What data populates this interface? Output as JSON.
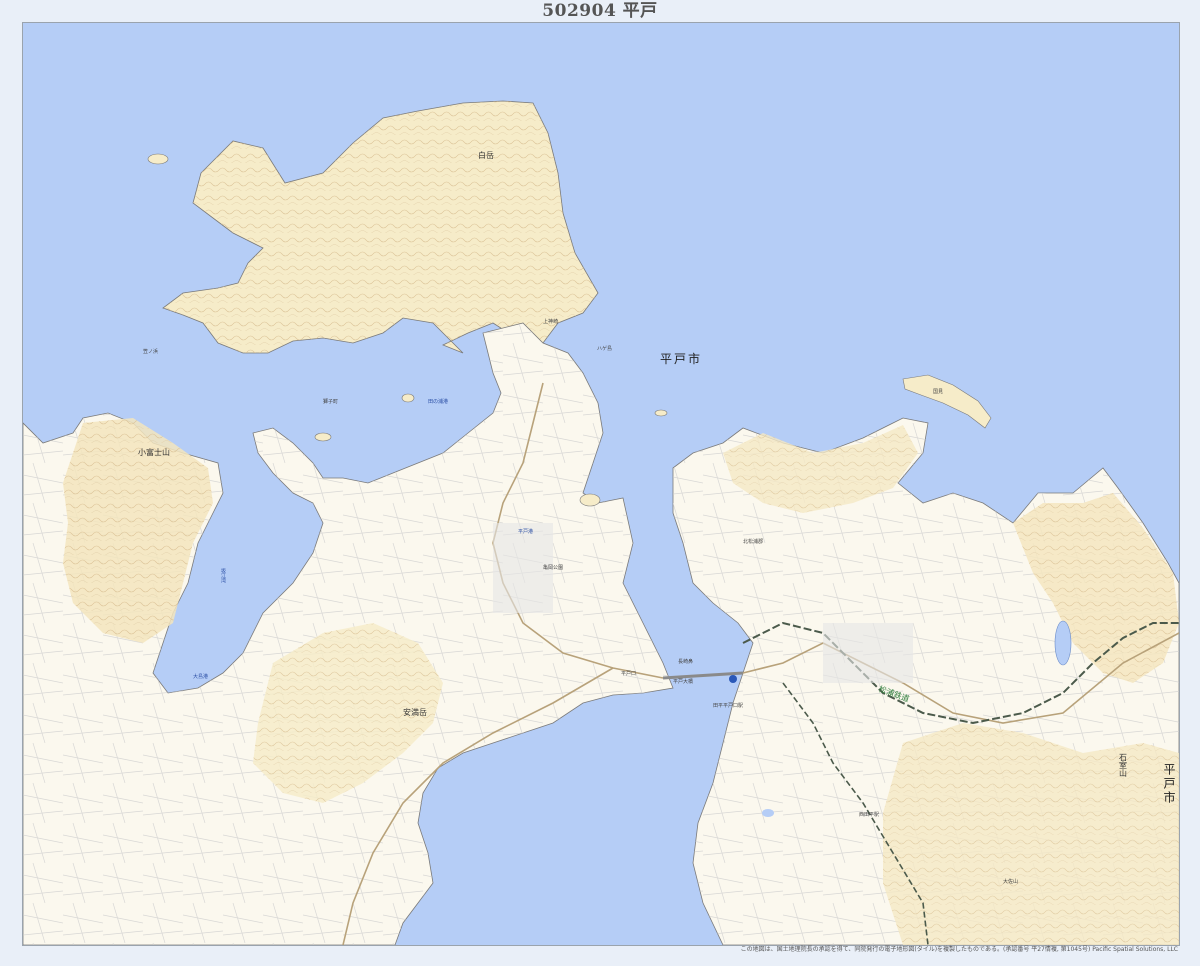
{
  "sheet": {
    "title": "502904  平戸"
  },
  "colors": {
    "sea": "#b5cdf6",
    "land": "#fbf8ee",
    "hill": "#f3e7c4",
    "contour": "#d8b98a",
    "road": "#c9c9c9",
    "rail": "#2e7d3b",
    "water_text": "#2b4fa5"
  },
  "labels": {
    "city_main": "平戸市",
    "city_edge": "平戸市",
    "shiroi": "白岳",
    "kofujisan": "小富士山",
    "yasumandake": "安満岳",
    "kouzan": "石室山",
    "osayama": "大佐山",
    "hiradohashi": "平戸大橋",
    "hiradoguchi": "平戸口",
    "tabirahiradoguchi": "田平平戸口駅",
    "matsuura_rail": "松浦鉄道",
    "nishitabira": "西田平駅",
    "hiradokou": "平戸港",
    "sakagawa": "坂江湾",
    "kasahama": "笠ノ浜",
    "kaminojima": "上神崎",
    "tanoura": "田の浦港",
    "hirado_castle": "亀岡公園",
    "shishi": "獅子町",
    "tabira_kita": "北松浦郡",
    "oshima_port": "大島港",
    "kunimi": "国見",
    "hagishima": "ハゲ島",
    "nagasaki_nose": "長崎鼻"
  },
  "credit": "この地図は、国土地理院長の承認を得て、同院発行の電子地形図(タイル)を複製したものである。(承認番号 平27情複, 第1045号)  Pacific Spatial Solutions, LLC"
}
